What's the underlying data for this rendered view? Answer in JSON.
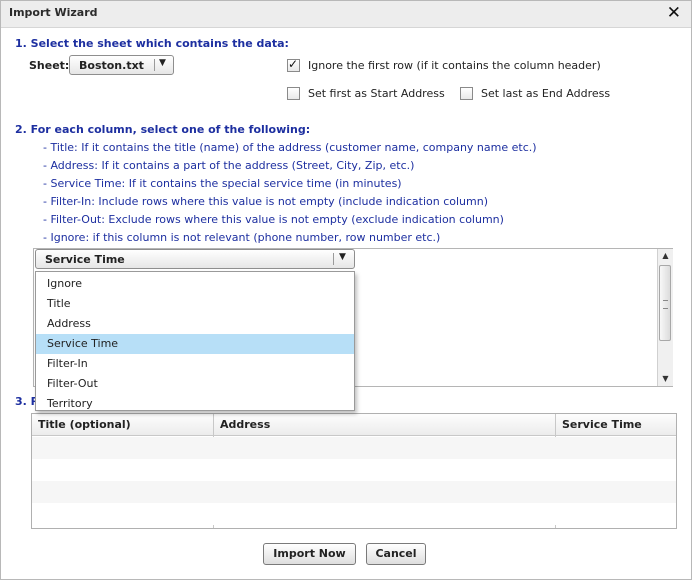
{
  "window": {
    "title": "Import Wizard",
    "close_glyph": "✕"
  },
  "step1": {
    "heading": "1. Select the sheet which contains the data:",
    "sheet_label": "Sheet:",
    "sheet_value": "Boston.txt",
    "ignore_first_row": {
      "label": "Ignore the first row (if it contains the column header)",
      "checked": true
    },
    "set_first_start": {
      "label": "Set first as Start Address",
      "checked": false
    },
    "set_last_end": {
      "label": "Set last as End Address",
      "checked": false
    }
  },
  "step2": {
    "heading": "2. For each column, select one of the following:",
    "descriptions": [
      "- Title: If it contains the title (name) of the address (customer name, company name etc.)",
      "- Address: If it contains a part of the address (Street, City, Zip, etc.)",
      "- Service Time: If it contains the special service time (in minutes)",
      "- Filter-In: Include rows where this value is not empty (include indication column)",
      "- Filter-Out: Exclude rows where this value is not empty (exclude indication column)",
      "- Ignore: if this column is not relevant (phone number, row number etc.)"
    ],
    "column_type_value": "Service Time",
    "column_type_options": [
      "Ignore",
      "Title",
      "Address",
      "Service Time",
      "Filter-In",
      "Filter-Out",
      "Territory"
    ],
    "selected_index": 3
  },
  "step3": {
    "heading_visible": "3. R",
    "columns": [
      "Title (optional)",
      "Address",
      "Service Time"
    ]
  },
  "buttons": {
    "import": "Import Now",
    "cancel": "Cancel"
  },
  "icons": {
    "dropdown": "chevron-down-icon",
    "close": "close-icon",
    "check": "checkmark-icon"
  },
  "colors": {
    "section_heading": "#1d2fa0",
    "selected_option": "#b7dff7"
  }
}
